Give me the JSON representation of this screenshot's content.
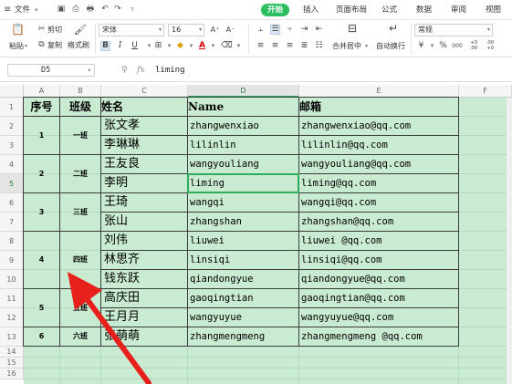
{
  "menu": {
    "file": "文件",
    "tabs": [
      "开始",
      "插入",
      "页面布局",
      "公式",
      "数据",
      "审阅",
      "视图"
    ],
    "active_tab": "开始"
  },
  "ribbon": {
    "paste": "粘贴",
    "cut": "剪切",
    "copy": "复制",
    "format_painter": "格式刷",
    "font_name": "宋体",
    "font_size": "16",
    "grow_font": "A⁺",
    "shrink_font": "A⁻",
    "bold": "B",
    "italic": "I",
    "underline": "U",
    "font_color_glyph": "A",
    "merge_center": "合并居中",
    "wrap_text": "自动换行",
    "number_format": "常规",
    "currency": "¥",
    "percent": "%",
    "thousands": "000",
    "inc_decimal": "+0 .00",
    "dec_decimal": ".00 +0"
  },
  "formula_bar": {
    "cell_ref": "D5",
    "fx_label": "fx",
    "value": "liming"
  },
  "sheet": {
    "columns": [
      "A",
      "B",
      "C",
      "D",
      "E",
      "F"
    ],
    "selected_column": "D",
    "row_numbers": [
      "1",
      "2",
      "3",
      "4",
      "5",
      "6",
      "7",
      "8",
      "9",
      "10",
      "11",
      "12",
      "13",
      "14",
      "15",
      "16"
    ],
    "selected_row": "5",
    "headers": [
      "序号",
      "班级",
      "姓名",
      "Name",
      "邮箱"
    ],
    "groups": [
      {
        "seq": "1",
        "class": "一班"
      },
      {
        "seq": "2",
        "class": "二班"
      },
      {
        "seq": "3",
        "class": "三班"
      },
      {
        "seq": "4",
        "class": "四班"
      },
      {
        "seq": "5",
        "class": "五班"
      },
      {
        "seq": "6",
        "class": "六班"
      }
    ],
    "rows": [
      {
        "name": "张文孝",
        "pinyin": "zhangwenxiao",
        "email": "zhangwenxiao@qq.com"
      },
      {
        "name": "李琳琳",
        "pinyin": "lilinlin",
        "email": "lilinlin@qq.com"
      },
      {
        "name": "王友良",
        "pinyin": "wangyouliang",
        "email": "wangyouliang@qq.com"
      },
      {
        "name": "李明",
        "pinyin": "liming",
        "email": "liming@qq.com"
      },
      {
        "name": "王琦",
        "pinyin": "wangqi",
        "email": "wangqi@qq.com"
      },
      {
        "name": "张山",
        "pinyin": "zhangshan",
        "email": "zhangshan@qq.com"
      },
      {
        "name": "刘伟",
        "pinyin": "liuwei",
        "email": "liuwei @qq.com"
      },
      {
        "name": "林思齐",
        "pinyin": "linsiqi",
        "email": "linsiqi@qq.com"
      },
      {
        "name": "钱东跃",
        "pinyin": "qiandongyue",
        "email": "qiandongyue@qq.com"
      },
      {
        "name": "高庆田",
        "pinyin": "gaoqingtian",
        "email": "gaoqingtian@qq.com"
      },
      {
        "name": "王月月",
        "pinyin": "wangyuyue",
        "email": "wangyuyue@qq.com"
      },
      {
        "name": "张萌萌",
        "pinyin": "zhangmengmeng",
        "email": "zhangmengmeng @qq.com"
      }
    ]
  },
  "colors": {
    "accent_green": "#2dbe60",
    "grid_fill": "#c9ebd1",
    "annotation_red": "#e8201c"
  }
}
